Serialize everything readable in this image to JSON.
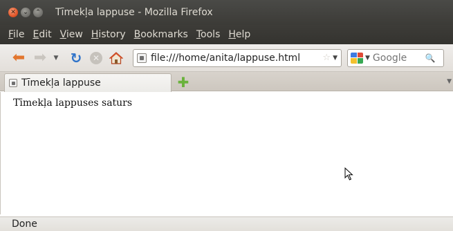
{
  "window": {
    "title": "Tīmekļa lappuse - Mozilla Firefox",
    "close_glyph": "✕",
    "min_glyph": "⌄",
    "max_glyph": "⌃"
  },
  "menubar": {
    "items": [
      "File",
      "Edit",
      "View",
      "History",
      "Bookmarks",
      "Tools",
      "Help"
    ]
  },
  "navbar": {
    "url": "file:///home/anita/lappuse.html",
    "search_placeholder": "Google",
    "icons": [
      "back-arrow-icon",
      "forward-arrow-icon",
      "history-dropdown-icon",
      "reload-icon",
      "stop-icon",
      "home-icon",
      "site-identity-icon",
      "bookmark-star-icon",
      "search-engine-icon",
      "search-magnifier-icon"
    ]
  },
  "tabs": {
    "items": [
      {
        "label": "Tīmekļa lappuse",
        "active": true
      }
    ],
    "newtab_glyph": "✚"
  },
  "content": {
    "text": "Tīmekļa lappuses saturs"
  },
  "statusbar": {
    "text": "Done"
  },
  "colors": {
    "titlebar_bg": "#3c3b37",
    "toolbar_bg": "#efedeb",
    "back_arrow": "#e2762e",
    "reload": "#2f73c9",
    "newtab_plus": "#6ab23c"
  }
}
